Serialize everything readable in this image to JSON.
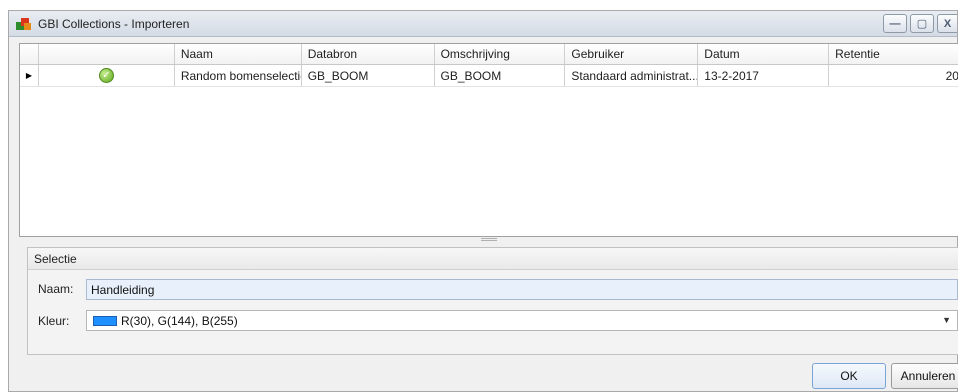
{
  "window": {
    "title": "GBI Collections - Importeren",
    "controls": {
      "minimize": "—",
      "maximize": "▢",
      "close": "X"
    }
  },
  "grid": {
    "columns": [
      "",
      "",
      "Naam",
      "Databron",
      "Omschrijving",
      "Gebruiker",
      "Datum",
      "Retentie"
    ],
    "rows": [
      {
        "selected_indicator": "▶",
        "status_icon": "check-icon",
        "naam": "Random bomenselectie",
        "databron": "GB_BOOM",
        "omschrijving": "GB_BOOM",
        "gebruiker": "Standaard administrat...",
        "datum": "13-2-2017",
        "retentie": "20"
      }
    ]
  },
  "selectie": {
    "header": "Selectie",
    "naam_label": "Naam:",
    "naam_value": "Handleiding",
    "kleur_label": "Kleur:",
    "kleur_value": "R(30), G(144), B(255)",
    "kleur_color": "#1e90ff"
  },
  "buttons": {
    "ok": "OK",
    "cancel": "Annuleren"
  }
}
